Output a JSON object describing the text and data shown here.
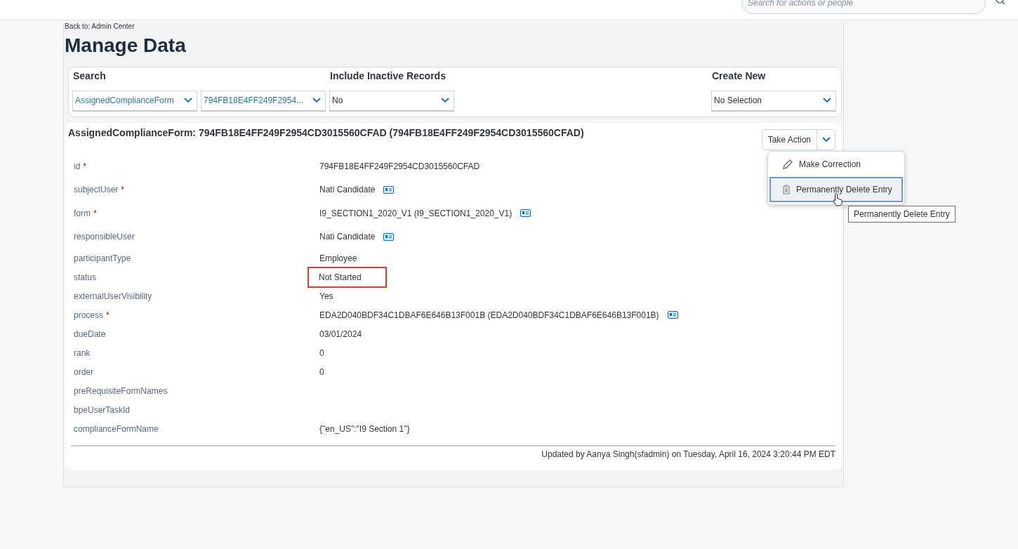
{
  "header": {
    "search": {
      "placeholder": "Search for actions or people"
    }
  },
  "back_link": "Back to: Admin Center",
  "title": "Manage Data",
  "search_panel": {
    "search_label": "Search",
    "inactive_label": "Include Inactive Records",
    "create_label": "Create New",
    "selects": [
      {
        "kind": "entity",
        "value": "AssignedComplianceForm"
      },
      {
        "kind": "entity",
        "value": "794FB18E4FF249F2954..."
      },
      {
        "kind": "plain",
        "value": "No"
      },
      {
        "kind": "plain",
        "value": "No Selection"
      }
    ]
  },
  "record": {
    "title": "AssignedComplianceForm: 794FB18E4FF249F2954CD3015560CFAD (794FB18E4FF249F2954CD3015560CFAD)",
    "take_action": "Take Action",
    "menu": [
      {
        "label": "Make Correction",
        "kind": "edit",
        "selected": false
      },
      {
        "label": "Permanently Delete Entry",
        "kind": "delete",
        "selected": true
      }
    ],
    "tooltip": "Permanently Delete Entry",
    "fields": [
      {
        "label": "id",
        "marker": "*",
        "value": "794FB18E4FF249F2954CD3015560CFAD",
        "card": false,
        "highlighted": false
      },
      {
        "label": "subjectUser",
        "marker": "*",
        "value": "Nati Candidate",
        "card": true,
        "highlighted": false
      },
      {
        "label": "form",
        "marker": "*",
        "value": "I9_SECTION1_2020_V1 (I9_SECTION1_2020_V1)",
        "card": true,
        "highlighted": false
      },
      {
        "label": "responsibleUser",
        "value": "Nati Candidate",
        "card": true,
        "highlighted": false
      },
      {
        "label": "participantType",
        "value": "Employee",
        "card": false,
        "highlighted": false
      },
      {
        "label": "status",
        "value": "Not Started",
        "card": false,
        "highlighted": true
      },
      {
        "label": "externalUserVisibility",
        "value": "Yes",
        "card": false,
        "highlighted": false
      },
      {
        "label": "process",
        "marker": "*",
        "value": "EDA2D040BDF34C1DBAF6E646B13F001B (EDA2D040BDF34C1DBAF6E646B13F001B)",
        "card": true,
        "highlighted": false
      },
      {
        "label": "dueDate",
        "value": "03/01/2024",
        "card": false,
        "highlighted": false
      },
      {
        "label": "rank",
        "value": "0",
        "card": false,
        "highlighted": false
      },
      {
        "label": "order",
        "value": "0",
        "card": false,
        "highlighted": false
      },
      {
        "label": "preRequisiteFormNames",
        "card": false,
        "highlighted": false
      },
      {
        "label": "bpeUserTaskId",
        "card": false,
        "highlighted": false
      },
      {
        "label": "complianceFormName",
        "value": "{\"en_US\":\"I9 Section 1\"}",
        "card": false,
        "highlighted": false
      }
    ],
    "updated": "Updated by Aanya Singh(sfadmin) on Tuesday, April 16, 2024 3:20:44 PM EDT"
  }
}
